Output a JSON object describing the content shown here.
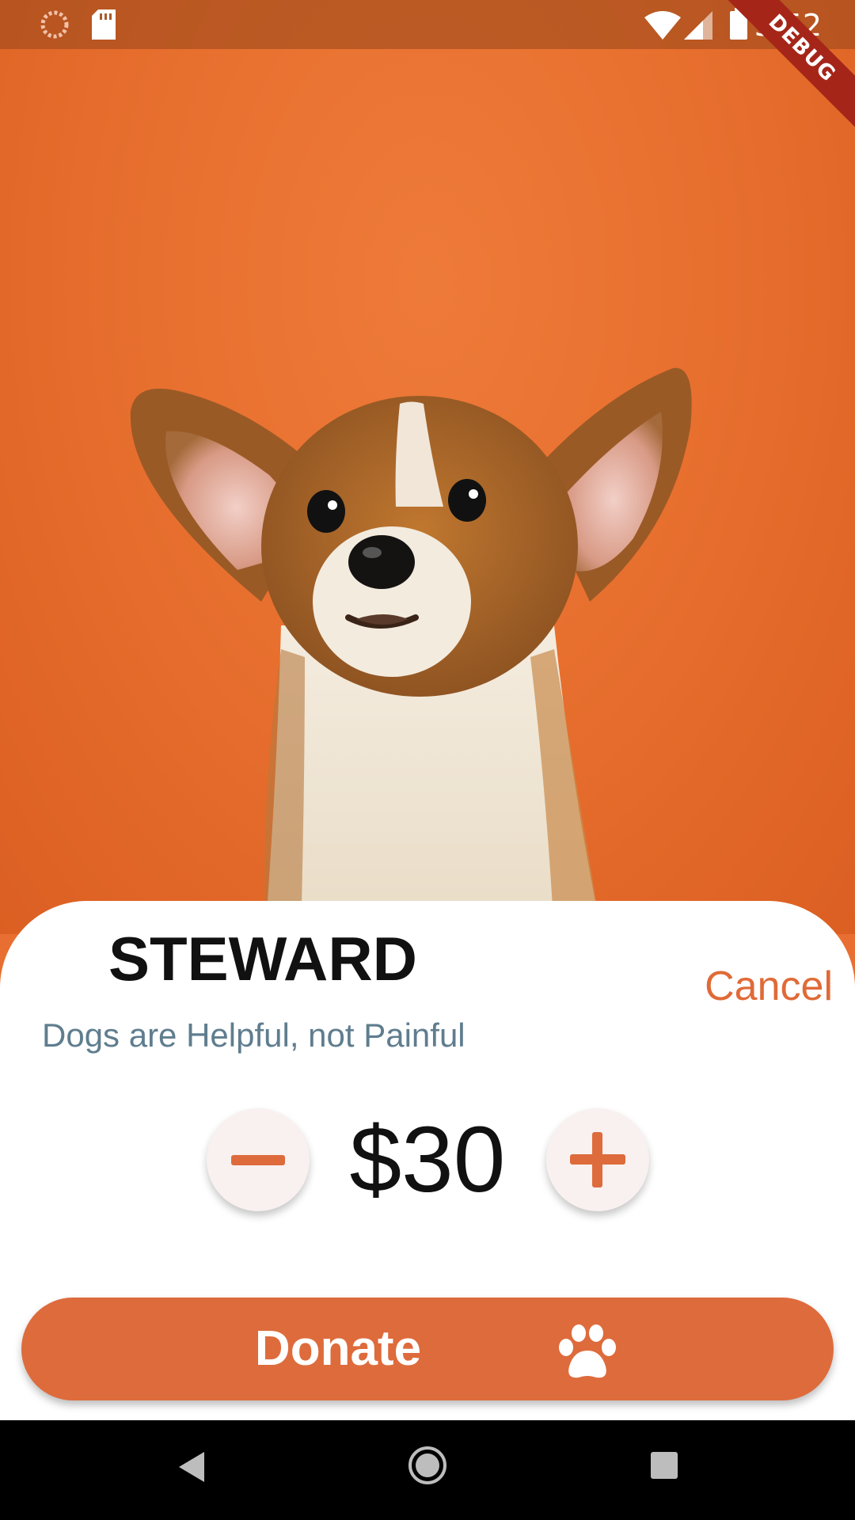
{
  "status_bar": {
    "time": "3:52",
    "debug_label": "DEBUG",
    "icons": [
      "loading-icon",
      "sd-card-icon",
      "wifi-icon",
      "signal-icon",
      "battery-icon"
    ]
  },
  "hero": {
    "image": "corgi-puppy-photo",
    "background_color": "#e8702f"
  },
  "donation": {
    "pet_name": "STEWARD",
    "cancel_label": "Cancel",
    "tagline": "Dogs are Helpful, not Painful",
    "amount": "$30",
    "decrement_icon": "minus-icon",
    "increment_icon": "plus-icon",
    "donate_label": "Donate",
    "donate_icon": "paw-icon"
  },
  "colors": {
    "accent": "#de6b3c",
    "cancel_text": "#e06a37",
    "tagline_text": "#5f7d8e"
  },
  "nav_bar": {
    "icons": [
      "back-icon",
      "home-icon",
      "recents-icon"
    ]
  }
}
